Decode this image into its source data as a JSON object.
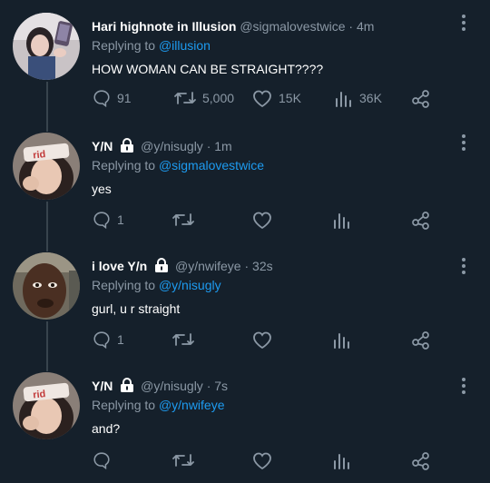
{
  "tweets": [
    {
      "name": "Hari highnote in Illusion",
      "handle": "@sigmalovestwice",
      "time": "4m",
      "replying_label": "Replying to",
      "replying_to": "@illusion",
      "text": "HOW WOMAN CAN BE STRAIGHT????",
      "locked": false,
      "replies": "91",
      "retweets": "5,000",
      "likes": "15K",
      "views": "36K"
    },
    {
      "name": "Y/N",
      "handle": "@y/nisugly",
      "time": "1m",
      "replying_label": "Replying to",
      "replying_to": "@sigmalovestwice",
      "text": "yes",
      "locked": true,
      "replies": "1",
      "retweets": "",
      "likes": "",
      "views": ""
    },
    {
      "name": "i love Y/n",
      "handle": "@y/nwifeye",
      "time": "32s",
      "replying_label": "Replying to",
      "replying_to": "@y/nisugly",
      "text": "gurl, u r straight",
      "locked": true,
      "replies": "1",
      "retweets": "",
      "likes": "",
      "views": ""
    },
    {
      "name": "Y/N",
      "handle": "@y/nisugly",
      "time": "7s",
      "replying_label": "Replying to",
      "replying_to": "@y/nwifeye",
      "text": "and?",
      "locked": true,
      "replies": "",
      "retweets": "",
      "likes": "",
      "views": ""
    }
  ],
  "separator": "·",
  "avatar_texts": {
    "headband": "rid"
  },
  "icons": [
    "reply-icon",
    "retweet-icon",
    "like-icon",
    "views-icon",
    "share-icon",
    "more-icon",
    "lock-icon"
  ],
  "colors": {
    "background": "#15202b",
    "text": "#ffffff",
    "muted": "#8b98a5",
    "link": "#1d9bf0",
    "thread_line": "#38444d"
  }
}
